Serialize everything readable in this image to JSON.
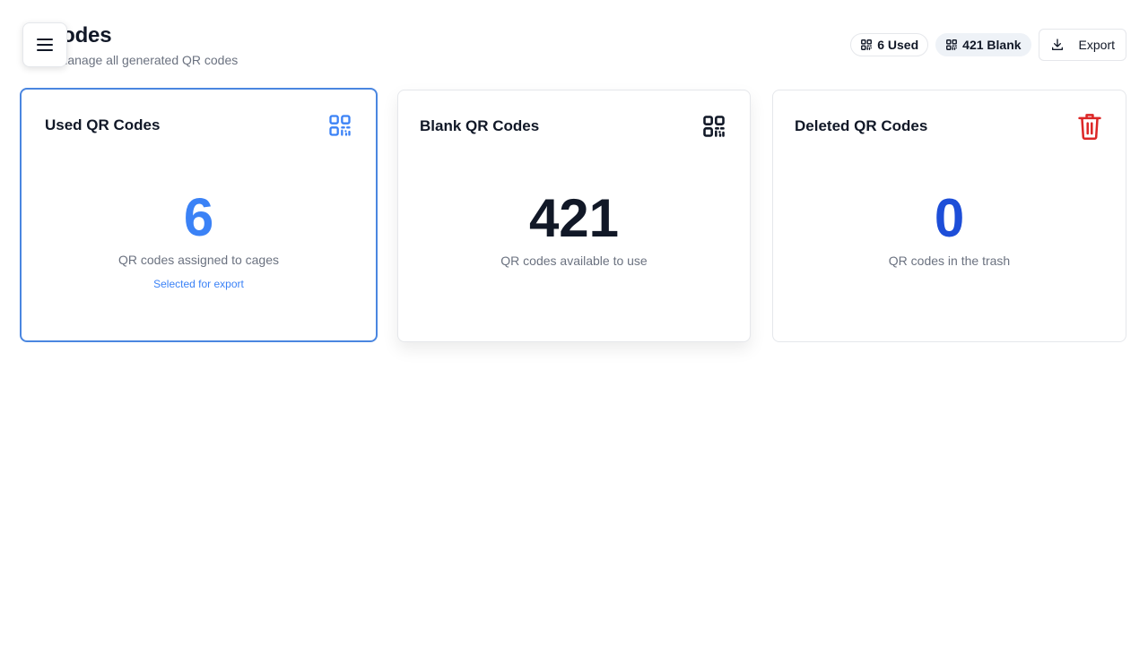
{
  "header": {
    "title": "Codes",
    "subtitle": "d manage all generated QR codes"
  },
  "actions": {
    "used_badge": "6 Used",
    "blank_badge": "421 Blank",
    "export_label": "Export"
  },
  "cards": [
    {
      "title": "Used QR Codes",
      "value": "6",
      "description": "QR codes assigned to cages",
      "note": "Selected for export",
      "icon": "qr-code-icon",
      "value_color": "#3b82f6"
    },
    {
      "title": "Blank QR Codes",
      "value": "421",
      "description": "QR codes available to use",
      "icon": "qr-code-icon",
      "value_color": "#111827"
    },
    {
      "title": "Deleted QR Codes",
      "value": "0",
      "description": "QR codes in the trash",
      "icon": "trash-icon",
      "value_color": "#1d4ed8"
    }
  ],
  "colors": {
    "accent": "#3b82f6",
    "danger": "#dc2626",
    "border": "#e5e7eb"
  }
}
